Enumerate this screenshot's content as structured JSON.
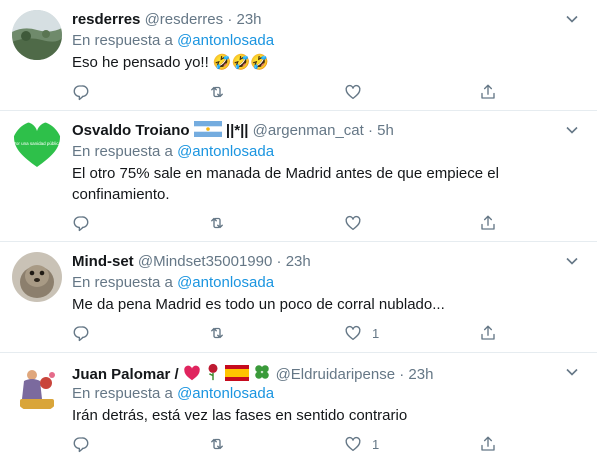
{
  "reply_prefix": "En respuesta a",
  "tweets": [
    {
      "name": "resderres",
      "handle": "@resderres",
      "separator": "·",
      "time": "23h",
      "reply_to": "@antonlosada",
      "text": "Eso he pensado yo!! 🤣🤣🤣",
      "likes": "",
      "avatar": "landscape-photo-avatar"
    },
    {
      "name": "Osvaldo Troiano",
      "name_suffix": "||*||",
      "handle": "@argenman_cat",
      "separator": "·",
      "time": "5h",
      "reply_to": "@antonlosada",
      "text": "El otro 75% sale en manada de Madrid antes de que empiece el confinamiento.",
      "likes": "",
      "avatar": "green-heart-avatar",
      "avatar_text": "Por una sanidad pública"
    },
    {
      "name": "Mind-set",
      "handle": "@Mindset35001990",
      "separator": "·",
      "time": "23h",
      "reply_to": "@antonlosada",
      "text": "Me da pena Madrid es todo un poco de corral nublado...",
      "likes": "1",
      "avatar": "seal-photo-avatar"
    },
    {
      "name": "Juan Palomar /",
      "handle": "@Eldruidaripense",
      "separator": "·",
      "time": "23h",
      "reply_to": "@antonlosada",
      "text": "Irán detrás, está vez las fases en sentido contrario",
      "likes": "1",
      "avatar": "figurine-photo-avatar"
    }
  ],
  "colors": {
    "accent": "#1b95e0",
    "secondary_text": "#657786",
    "border": "#e6ecf0"
  },
  "icons": [
    "reply-icon",
    "retweet-icon",
    "like-icon",
    "share-icon",
    "chevron-down-icon"
  ]
}
